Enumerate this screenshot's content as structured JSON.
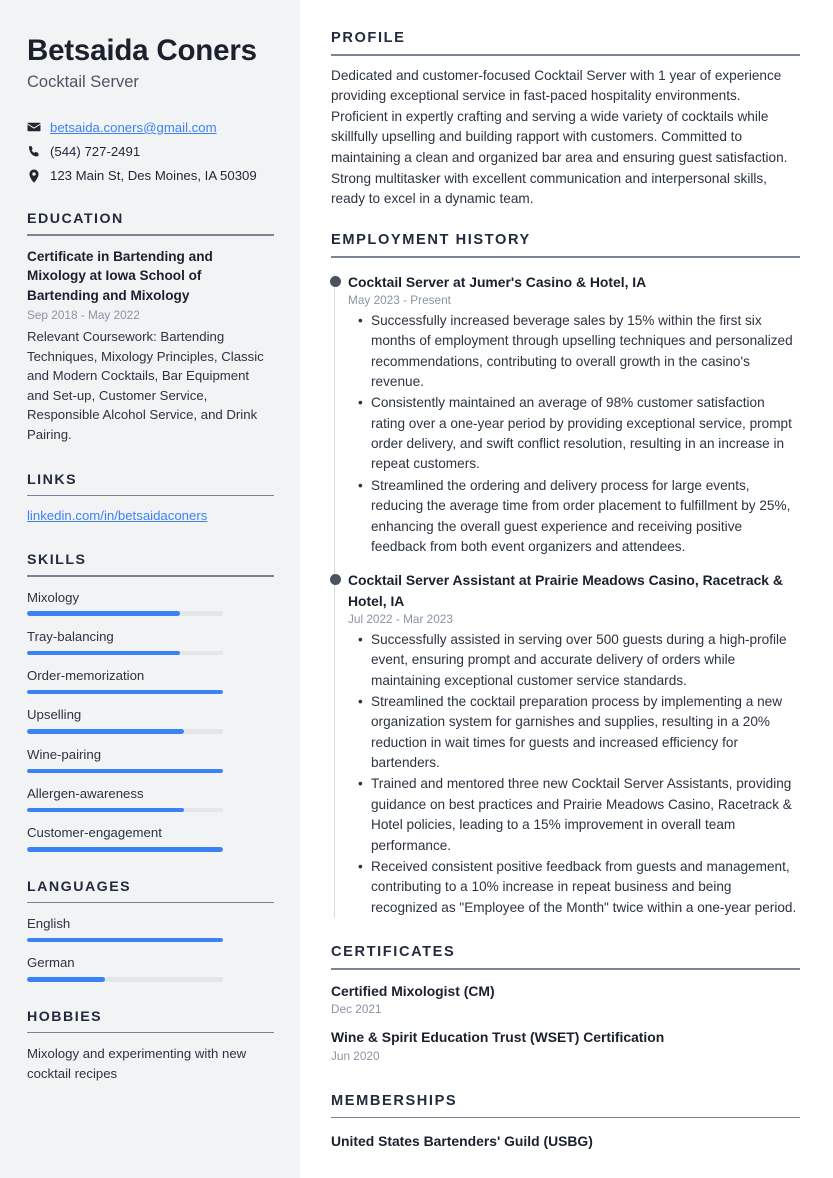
{
  "theme": {
    "accent": "#3b82f6",
    "heading": "#212b3b",
    "text": "#2c3440",
    "muted": "#8b94a3",
    "sidebar_bg": "#f1f3f5",
    "rule": "#7b8494",
    "dot": "#4a5260"
  },
  "header": {
    "name": "Betsaida Coners",
    "job_title": "Cocktail Server",
    "contacts": [
      {
        "icon": "envelope-icon",
        "text": "betsaida.coners@gmail.com",
        "is_link": true
      },
      {
        "icon": "phone-icon",
        "text": "(544) 727-2491",
        "is_link": false
      },
      {
        "icon": "location-pin-icon",
        "text": "123 Main St, Des Moines, IA 50309",
        "is_link": false
      }
    ]
  },
  "sidebar": {
    "education": {
      "title": "EDUCATION",
      "entries": [
        {
          "title": "Certificate in Bartending and Mixology at Iowa School of Bartending and Mixology",
          "date": "Sep 2018 - May 2022",
          "description": "Relevant Coursework: Bartending Techniques, Mixology Principles, Classic and Modern Cocktails, Bar Equipment and Set-up, Customer Service, Responsible Alcohol Service, and Drink Pairing."
        }
      ]
    },
    "links": {
      "title": "LINKS",
      "items": [
        {
          "label": "linkedin.com/in/betsaidaconers"
        }
      ]
    },
    "skills": {
      "title": "SKILLS",
      "items": [
        {
          "label": "Mixology",
          "level": 78
        },
        {
          "label": "Tray-balancing",
          "level": 78
        },
        {
          "label": "Order-memorization",
          "level": 100
        },
        {
          "label": "Upselling",
          "level": 80
        },
        {
          "label": "Wine-pairing",
          "level": 100
        },
        {
          "label": "Allergen-awareness",
          "level": 80
        },
        {
          "label": "Customer-engagement",
          "level": 100
        }
      ]
    },
    "languages": {
      "title": "LANGUAGES",
      "items": [
        {
          "label": "English",
          "level": 100
        },
        {
          "label": "German",
          "level": 40
        }
      ]
    },
    "hobbies": {
      "title": "HOBBIES",
      "text": "Mixology and experimenting with new cocktail recipes"
    }
  },
  "main": {
    "profile": {
      "title": "PROFILE",
      "text": "Dedicated and customer-focused Cocktail Server with 1 year of experience providing exceptional service in fast-paced hospitality environments. Proficient in expertly crafting and serving a wide variety of cocktails while skillfully upselling and building rapport with customers. Committed to maintaining a clean and organized bar area and ensuring guest satisfaction. Strong multitasker with excellent communication and interpersonal skills, ready to excel in a dynamic team."
    },
    "employment": {
      "title": "EMPLOYMENT HISTORY",
      "jobs": [
        {
          "title": "Cocktail Server at Jumer's Casino & Hotel, IA",
          "date": "May 2023 - Present",
          "bullets": [
            "Successfully increased beverage sales by 15% within the first six months of employment through upselling techniques and personalized recommendations, contributing to overall growth in the casino's revenue.",
            "Consistently maintained an average of 98% customer satisfaction rating over a one-year period by providing exceptional service, prompt order delivery, and swift conflict resolution, resulting in an increase in repeat customers.",
            "Streamlined the ordering and delivery process for large events, reducing the average time from order placement to fulfillment by 25%, enhancing the overall guest experience and receiving positive feedback from both event organizers and attendees."
          ]
        },
        {
          "title": "Cocktail Server Assistant at Prairie Meadows Casino, Racetrack & Hotel, IA",
          "date": "Jul 2022 - Mar 2023",
          "bullets": [
            "Successfully assisted in serving over 500 guests during a high-profile event, ensuring prompt and accurate delivery of orders while maintaining exceptional customer service standards.",
            "Streamlined the cocktail preparation process by implementing a new organization system for garnishes and supplies, resulting in a 20% reduction in wait times for guests and increased efficiency for bartenders.",
            "Trained and mentored three new Cocktail Server Assistants, providing guidance on best practices and Prairie Meadows Casino, Racetrack & Hotel policies, leading to a 15% improvement in overall team performance.",
            "Received consistent positive feedback from guests and management, contributing to a 10% increase in repeat business and being recognized as \"Employee of the Month\" twice within a one-year period."
          ]
        }
      ]
    },
    "certificates": {
      "title": "CERTIFICATES",
      "items": [
        {
          "name": "Certified Mixologist (CM)",
          "date": "Dec 2021"
        },
        {
          "name": "Wine & Spirit Education Trust (WSET) Certification",
          "date": "Jun 2020"
        }
      ]
    },
    "memberships": {
      "title": "MEMBERSHIPS",
      "items": [
        {
          "name": "United States Bartenders' Guild (USBG)"
        }
      ]
    }
  }
}
